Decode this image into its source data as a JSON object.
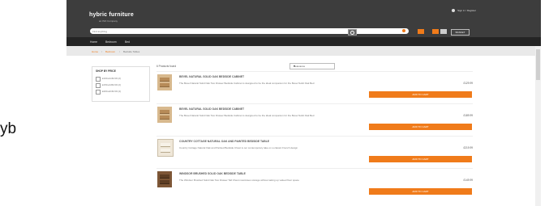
{
  "stray_text": "yb",
  "header": {
    "logo_text": "hybric furniture",
    "logo_sub": "an ISO Company",
    "signin": "Sign in / Register",
    "search_placeholder": "Find anything",
    "basket_label": "BASKET"
  },
  "nav": {
    "items": [
      "Home",
      "Bedroom",
      "Bed"
    ]
  },
  "breadcrumb": {
    "items": [
      "Home",
      "Bedroom",
      "Bedside Tables"
    ]
  },
  "sidebar": {
    "title": "SHOP BY PRICE",
    "options": [
      "£100-£149.99 (2)",
      "£150-£199.99 (2)",
      "£200-£249.99 (4)"
    ]
  },
  "listing": {
    "count": "6 Products found",
    "sort_selected": "Relevance"
  },
  "products": [
    {
      "title": "BEVEL NATURAL SOLID OAK BEDSIDE CABINET",
      "description": "The Bevel Natural Solid Oak Two Drawer Bedside Cabinet is designed to be the ideal companion for the Bevel Solid Oak Bed",
      "price": "£129.99",
      "button": "ADD TO CART"
    },
    {
      "title": "BEVEL NATURAL SOLID OAK BEDSIDE CABINET",
      "description": "The Bevel Natural Solid Oak Two Drawer Bedside Cabinet is designed to be the ideal companion for the Bevel Solid Oak Bed",
      "price": "£189.99",
      "button": "ADD TO CART"
    },
    {
      "title": "COUNTRY COTTAGE NATURAL OAK AND PAINTED BEDSIDE TABLE",
      "description": "Country Cottage Natural Oak and Painted Bedside Chest is our contemporary take on a classic French design",
      "price": "£219.99",
      "button": "ADD TO CART"
    },
    {
      "title": "WINDSOR BRUSHED SOLID OAK BEDSIDE TABLE",
      "description": "The Windsor Brushed Solid Oak Two Drawer Tall Chest maximises storage without taking up valued floor space",
      "price": "£149.99",
      "button": "ADD TO CART"
    }
  ],
  "colors": {
    "header_bg": "#3d3d3d",
    "nav_bg": "#242424",
    "accent": "#f07b1a"
  }
}
